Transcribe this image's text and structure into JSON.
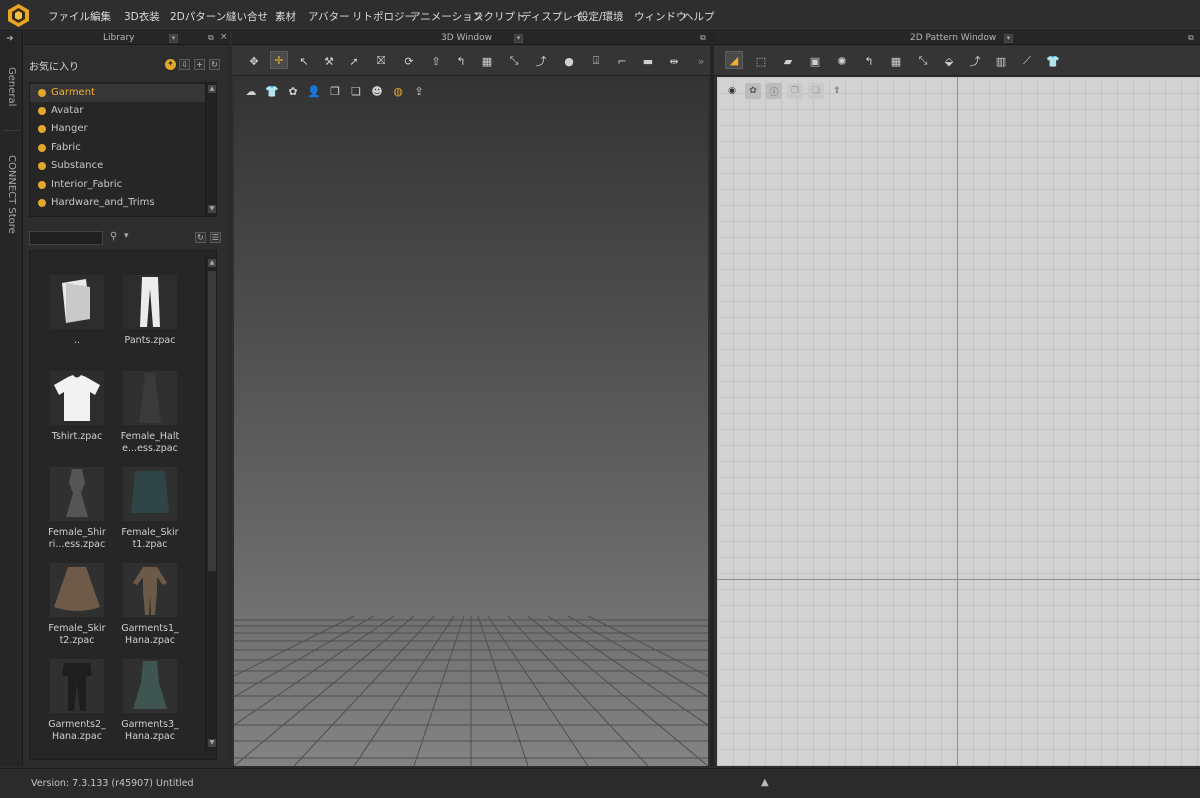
{
  "menu": [
    "ファイル",
    "編集",
    "3D衣装",
    "2Dパターン",
    "縫い合せ",
    "素材",
    "アバター",
    "リトポロジー",
    "アニメーション",
    "スクリプト",
    "ディスプレイ",
    "設定/環境",
    "ウィンドウ",
    "ヘルプ"
  ],
  "side_tabs": {
    "general": "General",
    "store": "CONNECT Store"
  },
  "library": {
    "title": "Library",
    "favorites_label": "お気に入り",
    "folders": [
      "Garment",
      "Avatar",
      "Hanger",
      "Fabric",
      "Substance",
      "Interior_Fabric",
      "Hardware_and_Trims"
    ],
    "selected_folder": "Garment",
    "search_value": "",
    "files": [
      {
        "label": "..",
        "icon": "folder-up-icon"
      },
      {
        "label": "Pants.zpac",
        "icon": "pants-icon"
      },
      {
        "label": "Tshirt.zpac",
        "icon": "tshirt-icon"
      },
      {
        "label": "Female_Halt e...ess.zpac",
        "icon": "dress-icon"
      },
      {
        "label": "Female_Shir ri...ess.zpac",
        "icon": "dress-icon"
      },
      {
        "label": "Female_Skir t1.zpac",
        "icon": "skirt-icon"
      },
      {
        "label": "Female_Skir t2.zpac",
        "icon": "skirt-icon"
      },
      {
        "label": "Garments1_ Hana.zpac",
        "icon": "outfit-icon"
      },
      {
        "label": "Garments2_ Hana.zpac",
        "icon": "outfit-icon"
      },
      {
        "label": "Garments3_ Hana.zpac",
        "icon": "dress-icon"
      }
    ]
  },
  "window3d": {
    "title": "3D Window"
  },
  "window2d": {
    "title": "2D Pattern Window"
  },
  "status": {
    "text": "Version:    7.3.133 (r45907)    Untitled"
  },
  "colors": {
    "accent": "#f0b030",
    "folder_dot": "#e2a82b",
    "pattern_bg": "#d2d2d2"
  }
}
